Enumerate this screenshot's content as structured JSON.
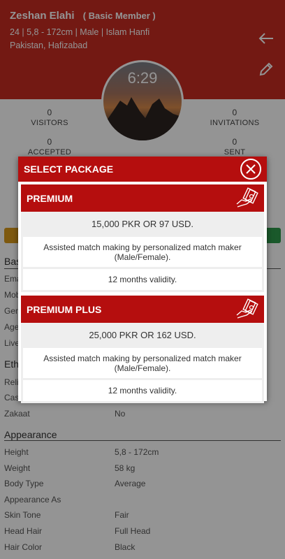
{
  "profile": {
    "name": "Zeshan Elahi",
    "membership": "( Basic Member )",
    "details": "24 | 5,8 - 172cm | Male | Islam Hanfi",
    "location": "Pakistan, Hafizabad",
    "avatar_clock": "6:29"
  },
  "header_icons": [
    "back-arrow-icon",
    "edit-pencil-icon"
  ],
  "stats": {
    "visitors": {
      "count": "0",
      "label": "VISITORS"
    },
    "invitations": {
      "count": "0",
      "label": "INVITATIONS"
    },
    "accepted": {
      "count": "0",
      "label": "ACCEPTED"
    },
    "sent": {
      "count": "0",
      "label": "SENT"
    }
  },
  "background_rows": {
    "basic_title_stub": "Bas",
    "basic_stubs": [
      "Ema",
      "Mob",
      "Gen",
      "Age",
      "Live"
    ],
    "ethnicity_stub": "Eth",
    "ethnicity_stubs": [
      "Reli",
      "Cas"
    ],
    "zakaat": {
      "label": "Zakaat",
      "value": "No"
    }
  },
  "appearance": {
    "title": "Appearance",
    "rows": [
      {
        "label": "Height",
        "value": "5,8 - 172cm"
      },
      {
        "label": "Weight",
        "value": "58 kg"
      },
      {
        "label": "Body Type",
        "value": "Average"
      },
      {
        "label": "Appearance As",
        "value": ""
      },
      {
        "label": "Skin Tone",
        "value": "Fair"
      },
      {
        "label": "Head Hair",
        "value": "Full Head"
      },
      {
        "label": "Hair Color",
        "value": "Black"
      }
    ]
  },
  "dialog": {
    "title": "SELECT PACKAGE",
    "packages": [
      {
        "name": "PREMIUM",
        "price": "15,000 PKR OR 97 USD.",
        "feature_line1": "Assisted match making by personalized match maker",
        "feature_line2": "(Male/Female).",
        "validity": "12 months validity."
      },
      {
        "name": "PREMIUM PLUS",
        "price": "25,000 PKR OR 162 USD.",
        "feature_line1": "Assisted match making by personalized match maker",
        "feature_line2": "(Male/Female).",
        "validity": "12 months validity."
      }
    ]
  },
  "colors": {
    "header_red": "#c62b22",
    "dialog_red": "#b50e0e",
    "overlay": "rgba(0,0,0,0.42)"
  }
}
